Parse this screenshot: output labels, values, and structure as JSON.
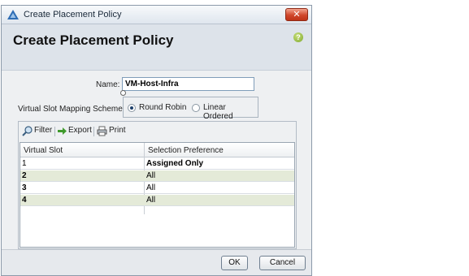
{
  "window": {
    "title": "Create Placement Policy"
  },
  "header": {
    "title": "Create Placement Policy",
    "help_icon": "help-icon"
  },
  "form": {
    "name_label": "Name:",
    "name_value": "VM-Host-Infra",
    "scheme_label": "Virtual Slot Mapping Scheme:",
    "scheme_options": [
      "Round Robin",
      "Linear Ordered"
    ],
    "scheme_selected": "Round Robin"
  },
  "toolbar": {
    "filter": "Filter",
    "export": "Export",
    "print": "Print"
  },
  "table": {
    "columns": [
      "Virtual Slot",
      "Selection Preference"
    ],
    "rows": [
      {
        "slot": "1",
        "pref": "Assigned Only"
      },
      {
        "slot": "2",
        "pref": "All"
      },
      {
        "slot": "3",
        "pref": "All"
      },
      {
        "slot": "4",
        "pref": "All"
      }
    ]
  },
  "buttons": {
    "ok": "OK",
    "cancel": "Cancel"
  },
  "colors": {
    "alt_row": "#e4ead8",
    "close_red": "#d0472b"
  }
}
